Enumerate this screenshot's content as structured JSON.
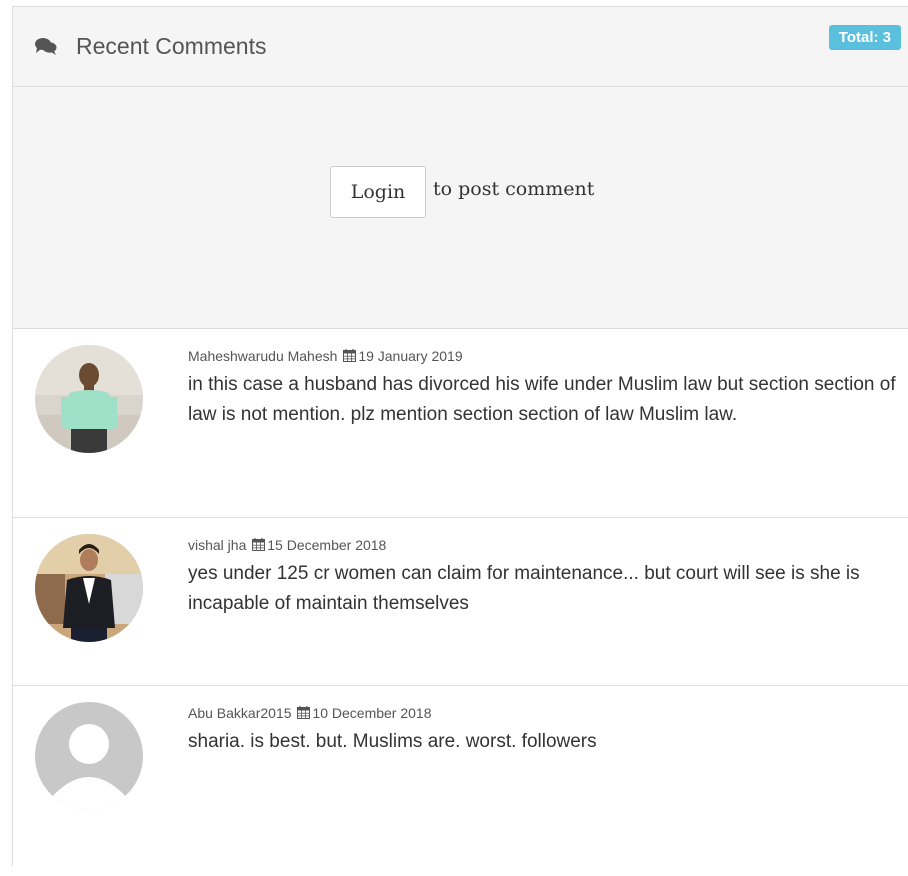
{
  "header": {
    "title": "Recent Comments",
    "icon": "comments-icon",
    "total_badge": "Total: 3",
    "badge_color": "#5bc0de"
  },
  "login_prompt": {
    "button_label": "Login",
    "suffix": "to post comment"
  },
  "comments": [
    {
      "author": "Maheshwarudu Mahesh",
      "date": "19 January 2019",
      "text": "in this case a husband has divorced his wife under Muslim law but section section of law is not mention. plz mention section section of law Muslim law.",
      "avatar": "user-photo"
    },
    {
      "author": "vishal jha",
      "date": "15 December 2018",
      "text": "yes under 125 cr women can claim for maintenance... but court will see is she is incapable of maintain themselves",
      "avatar": "user-photo"
    },
    {
      "author": "Abu Bakkar2015",
      "date": "10 December 2018",
      "text": "sharia. is best. but. Muslims are. worst. followers",
      "avatar": "default-avatar-icon"
    }
  ]
}
